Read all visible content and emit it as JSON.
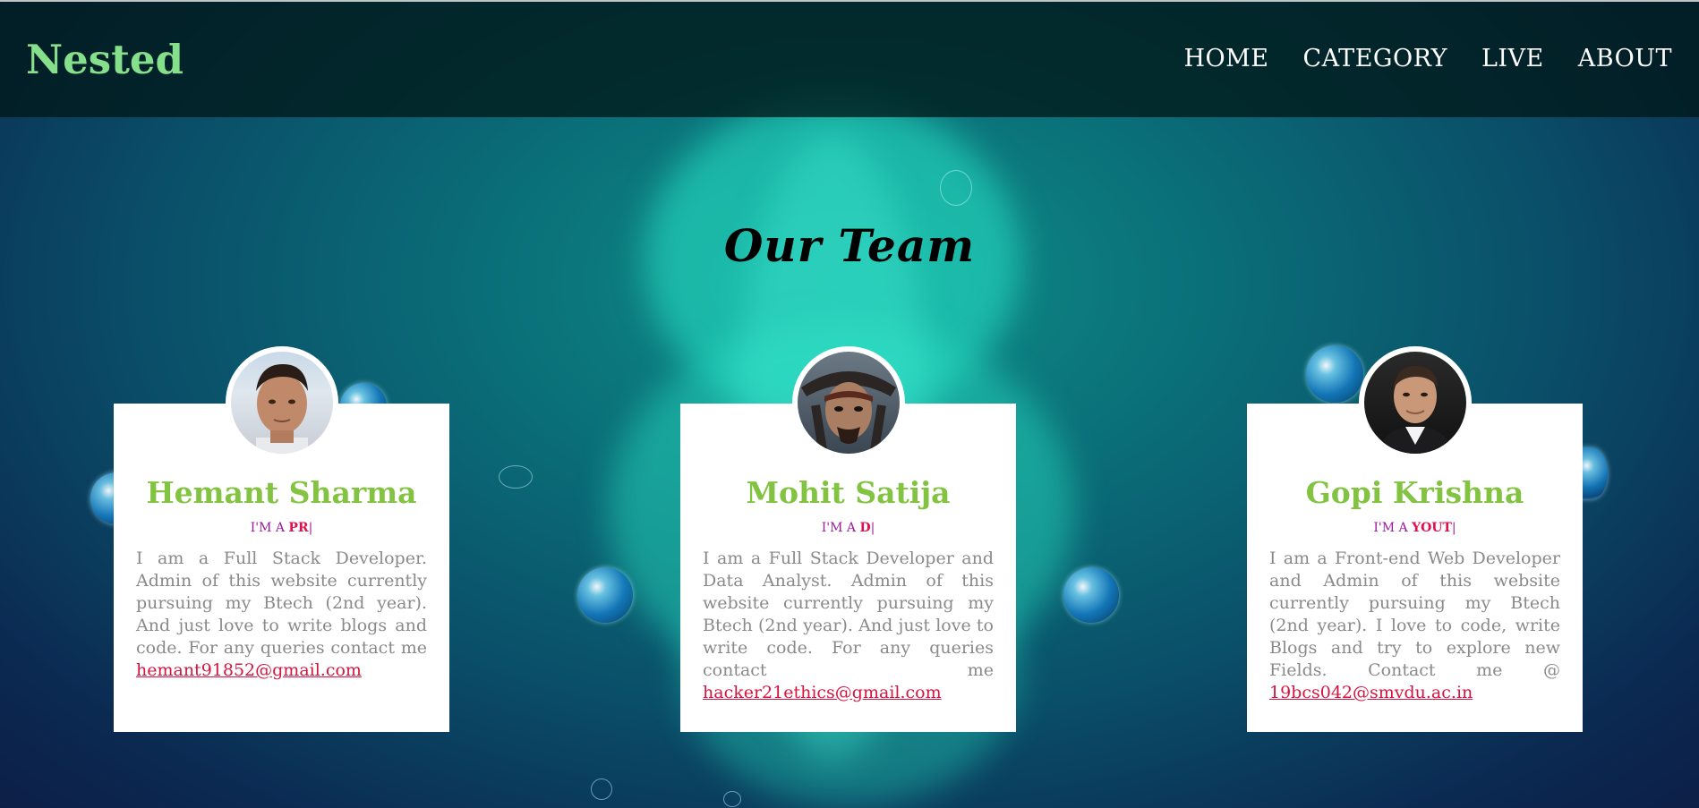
{
  "header": {
    "brand": "Nested",
    "nav": [
      "HOME",
      "CATEGORY",
      "LIVE",
      "ABOUT"
    ]
  },
  "section": {
    "title": "Our Team"
  },
  "members": [
    {
      "name": "Hemant Sharma",
      "role_prefix": "I'M A ",
      "role_typed": "PR",
      "caret": "|",
      "description": "I am a Full Stack Developer. Admin of this website currently pursuing my Btech (2nd year). And just love to write blogs and code. For any queries contact me",
      "email": "hemant91852@gmail.com"
    },
    {
      "name": "Mohit Satija",
      "role_prefix": "I'M A ",
      "role_typed": "D",
      "caret": "|",
      "description": "I am a Full Stack Developer and Data Analyst. Admin of this website currently pursuing my Btech (2nd year). And just love to write code. For any queries contact me",
      "email": "hacker21ethics@gmail.com"
    },
    {
      "name": "Gopi Krishna",
      "role_prefix": "I'M A ",
      "role_typed": "YOUT",
      "caret": "|",
      "description": "I am a Front-end Web Developer and Admin of this website currently pursuing my Btech (2nd year). I love to code, write Blogs and try to explore new Fields. Contact me @",
      "email": "19bcs042@smvdu.ac.in"
    }
  ],
  "colors": {
    "brand": "#86e08b",
    "member_name": "#82c341",
    "role_text": "#9b1a9e",
    "role_highlight": "#e0104e",
    "email_link": "#d6143f"
  }
}
